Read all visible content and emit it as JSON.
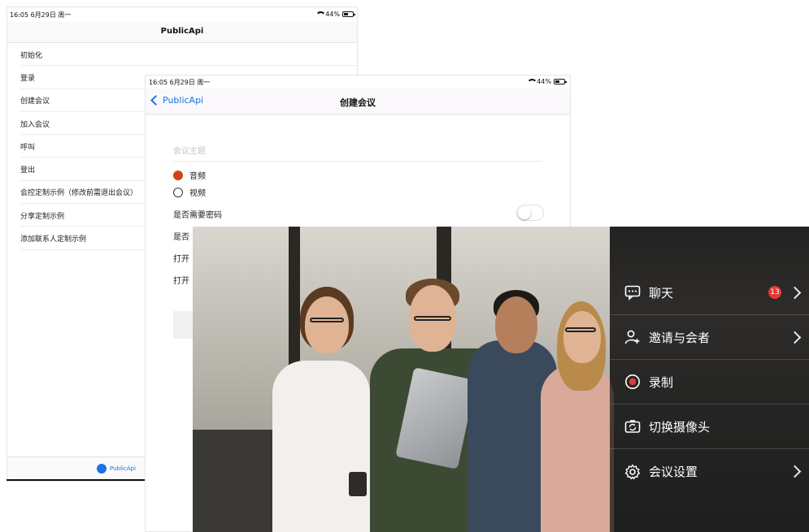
{
  "list_screen": {
    "status": {
      "time": "16:05  6月29日 周一",
      "battery": "44%"
    },
    "nav_title": "PublicApi",
    "items": [
      "初始化",
      "登录",
      "创建会议",
      "加入会议",
      "呼叫",
      "登出",
      "会控定制示例（修改前需退出会议）",
      "分享定制示例",
      "添加联系人定制示例"
    ],
    "tab_label": "PublicApi"
  },
  "create_screen": {
    "status": {
      "time": "16:05  6月29日 周一",
      "battery": "44%"
    },
    "back_label": "PublicApi",
    "title": "创建会议",
    "topic_placeholder": "会议主题",
    "radio_audio": "音频",
    "radio_video": "视频",
    "need_password": "是否需要密码",
    "row2_partial": "是否",
    "row3_partial": "打开",
    "row4_partial": "打开"
  },
  "meeting_menu": {
    "items": [
      {
        "label": "聊天",
        "icon": "chat-icon",
        "badge": "13",
        "has_chevron": true
      },
      {
        "label": "邀请与会者",
        "icon": "add-person-icon",
        "has_chevron": true
      },
      {
        "label": "录制",
        "icon": "record-icon",
        "has_chevron": false
      },
      {
        "label": "切换摄像头",
        "icon": "switch-camera-icon",
        "has_chevron": false
      },
      {
        "label": "会议设置",
        "icon": "gear-icon",
        "has_chevron": true
      }
    ]
  },
  "colors": {
    "accent_blue": "#1a73e8",
    "radio_selected": "#d3401a",
    "badge_red": "#e53935",
    "record_red": "#e53935"
  }
}
